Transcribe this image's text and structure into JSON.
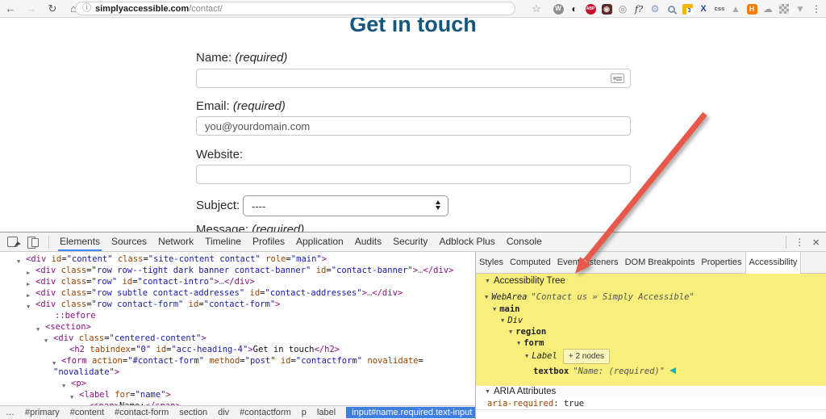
{
  "colors": {
    "heading_blue": "#15567d",
    "a11y_highlight": "#f8ee7c",
    "crumb_selected_bg": "#3d7edf",
    "annotation_arrow_red": "#e9594b",
    "devtools_tab_underline": "#4285f4"
  },
  "browser": {
    "nav": {
      "back": "←",
      "forward": "→",
      "reload": "↻",
      "home": "⌂"
    },
    "url": {
      "info_icon": "ⓘ",
      "host": "simplyaccessible.com",
      "path": "/contact/"
    },
    "bookmark_star": "☆",
    "menu_dots": "⋮",
    "extensions": [
      {
        "name": "wappalyzer-icon",
        "shape": "circle",
        "glyph": "W",
        "fg": "#ffffff",
        "bg": "#8d8d8d"
      },
      {
        "name": "contrast-icon",
        "shape": "glyph",
        "glyph": "◐",
        "fg": "#222222"
      },
      {
        "name": "adblock-plus-icon",
        "shape": "circle-small-text",
        "glyph": "ABP",
        "fg": "#ffffff",
        "bg": "#c70d2c"
      },
      {
        "name": "screen-capture-icon",
        "shape": "square",
        "glyph": "◉",
        "fg": "#e8d7d7",
        "bg": "#5a2a28"
      },
      {
        "name": "camera-icon",
        "shape": "glyph",
        "glyph": "◎",
        "fg": "#8a8a8a"
      },
      {
        "name": "function-help-icon",
        "shape": "text-italic",
        "glyph": "f?",
        "fg": "#333333"
      },
      {
        "name": "gear-icon",
        "shape": "glyph",
        "glyph": "⚙",
        "fg": "#8591c8"
      },
      {
        "name": "magnifier-icon",
        "shape": "mag",
        "glyph": "",
        "fg": "#8296ab"
      },
      {
        "name": "calendar-icon",
        "shape": "calendar",
        "glyph": "3",
        "fg": "#1a56c4",
        "bg": "#f4b400"
      },
      {
        "name": "axe-icon",
        "shape": "text-bold",
        "glyph": "X",
        "fg": "#23409a"
      },
      {
        "name": "css-icon",
        "shape": "text",
        "glyph": "css",
        "fg": "#555555"
      },
      {
        "name": "triangle-icon",
        "shape": "glyph",
        "glyph": "▲",
        "fg": "#a9a9a9"
      },
      {
        "name": "h-icon",
        "shape": "square",
        "glyph": "H",
        "fg": "#ffffff",
        "bg": "#f57c00"
      },
      {
        "name": "cloud-icon",
        "shape": "glyph",
        "glyph": "☁",
        "fg": "#9e9e9e"
      },
      {
        "name": "qr-icon",
        "shape": "qr",
        "glyph": "",
        "fg": "#a7a7a7"
      },
      {
        "name": "dropdown-icon",
        "shape": "glyph",
        "glyph": "▼",
        "fg": "#a9a9a9"
      }
    ]
  },
  "page": {
    "heading": "Get in touch",
    "name_label": "Name:",
    "name_required": "(required)",
    "name_value": "",
    "email_label": "Email:",
    "email_required": "(required)",
    "email_value": "you@yourdomain.com",
    "website_label": "Website:",
    "website_value": "",
    "subject_label": "Subject:",
    "subject_value": "----",
    "message_label": "Message:",
    "message_required": "(required)"
  },
  "devtools": {
    "tabs": [
      "Elements",
      "Sources",
      "Network",
      "Timeline",
      "Profiles",
      "Application",
      "Audits",
      "Security",
      "Adblock Plus",
      "Console"
    ],
    "active_tab": "Elements",
    "menu_dots": "⋮",
    "close": "×",
    "tree": [
      {
        "l": 32,
        "t": 2,
        "tg": "v",
        "k": [
          [
            "<div ",
            "t"
          ],
          [
            "id",
            "a"
          ],
          [
            "=",
            "p"
          ],
          [
            "\"content\"",
            "v"
          ],
          [
            " ",
            "p"
          ],
          [
            "class",
            "a"
          ],
          [
            "=",
            "p"
          ],
          [
            "\"site-content contact\"",
            "v"
          ],
          [
            " ",
            "p"
          ],
          [
            "role",
            "a"
          ],
          [
            "=",
            "p"
          ],
          [
            "\"main\"",
            "v"
          ],
          [
            ">",
            "t"
          ]
        ]
      },
      {
        "l": 44,
        "t": 16,
        "tg": ">",
        "k": [
          [
            "<div ",
            "t"
          ],
          [
            "class",
            "a"
          ],
          [
            "=",
            "p"
          ],
          [
            "\"row row--tight dark banner contact-banner\"",
            "v"
          ],
          [
            " ",
            "p"
          ],
          [
            "id",
            "a"
          ],
          [
            "=",
            "p"
          ],
          [
            "\"contact-banner\"",
            "v"
          ],
          [
            ">",
            "t"
          ],
          [
            "…",
            "d"
          ],
          [
            "</div>",
            "t"
          ]
        ]
      },
      {
        "l": 44,
        "t": 30,
        "tg": ">",
        "k": [
          [
            "<div ",
            "t"
          ],
          [
            "class",
            "a"
          ],
          [
            "=",
            "p"
          ],
          [
            "\"row\"",
            "v"
          ],
          [
            " ",
            "p"
          ],
          [
            "id",
            "a"
          ],
          [
            "=",
            "p"
          ],
          [
            "\"contact-intro\"",
            "v"
          ],
          [
            ">",
            "t"
          ],
          [
            "…",
            "d"
          ],
          [
            "</div>",
            "t"
          ]
        ]
      },
      {
        "l": 44,
        "t": 44,
        "tg": ">",
        "k": [
          [
            "<div ",
            "t"
          ],
          [
            "class",
            "a"
          ],
          [
            "=",
            "p"
          ],
          [
            "\"row subtle contact-addresses\"",
            "v"
          ],
          [
            " ",
            "p"
          ],
          [
            "id",
            "a"
          ],
          [
            "=",
            "p"
          ],
          [
            "\"contact-addresses\"",
            "v"
          ],
          [
            ">",
            "t"
          ],
          [
            "…",
            "d"
          ],
          [
            "</div>",
            "t"
          ]
        ]
      },
      {
        "l": 44,
        "t": 58,
        "tg": "v",
        "k": [
          [
            "<div ",
            "t"
          ],
          [
            "class",
            "a"
          ],
          [
            "=",
            "p"
          ],
          [
            "\"row contact-form\"",
            "v"
          ],
          [
            " ",
            "p"
          ],
          [
            "id",
            "a"
          ],
          [
            "=",
            "p"
          ],
          [
            "\"contact-form\"",
            "v"
          ],
          [
            ">",
            "t"
          ]
        ]
      },
      {
        "l": 68,
        "t": 72,
        "tg": "",
        "k": [
          [
            "::before",
            "t"
          ]
        ]
      },
      {
        "l": 56,
        "t": 86,
        "tg": "v",
        "k": [
          [
            "<section>",
            "t"
          ]
        ]
      },
      {
        "l": 66,
        "t": 100,
        "tg": "v",
        "k": [
          [
            "<div ",
            "t"
          ],
          [
            "class",
            "a"
          ],
          [
            "=",
            "p"
          ],
          [
            "\"centered-content\"",
            "v"
          ],
          [
            ">",
            "t"
          ]
        ]
      },
      {
        "l": 86,
        "t": 114,
        "tg": "",
        "k": [
          [
            "<h2 ",
            "t"
          ],
          [
            "tabindex",
            "a"
          ],
          [
            "=",
            "p"
          ],
          [
            "\"0\"",
            "v"
          ],
          [
            " ",
            "p"
          ],
          [
            "id",
            "a"
          ],
          [
            "=",
            "p"
          ],
          [
            "\"acc-heading-4\"",
            "v"
          ],
          [
            ">",
            "t"
          ],
          [
            "Get in touch",
            "p"
          ],
          [
            "</h2>",
            "t"
          ]
        ]
      },
      {
        "l": 76,
        "t": 128,
        "tg": "v",
        "k": [
          [
            "<form ",
            "t"
          ],
          [
            "action",
            "a"
          ],
          [
            "=",
            "p"
          ],
          [
            "\"#contact-form\"",
            "v"
          ],
          [
            " ",
            "p"
          ],
          [
            "method",
            "a"
          ],
          [
            "=",
            "p"
          ],
          [
            "\"post\"",
            "v"
          ],
          [
            " ",
            "p"
          ],
          [
            "id",
            "a"
          ],
          [
            "=",
            "p"
          ],
          [
            "\"contactform\"",
            "v"
          ],
          [
            " ",
            "p"
          ],
          [
            "novalidate",
            "a"
          ],
          [
            "=",
            "p"
          ]
        ]
      },
      {
        "l": 66,
        "t": 142,
        "tg": "",
        "k": [
          [
            "\"novalidate\"",
            "v"
          ],
          [
            ">",
            "t"
          ]
        ]
      },
      {
        "l": 88,
        "t": 156,
        "tg": "v",
        "k": [
          [
            "<p>",
            "t"
          ]
        ]
      },
      {
        "l": 98,
        "t": 170,
        "tg": "v",
        "k": [
          [
            "<label ",
            "t"
          ],
          [
            "for",
            "a"
          ],
          [
            "=",
            "p"
          ],
          [
            "\"name\"",
            "v"
          ],
          [
            ">",
            "t"
          ]
        ]
      },
      {
        "l": 110,
        "t": 184,
        "tg": "",
        "k": [
          [
            "<span>",
            "t"
          ],
          [
            "Name:",
            "p"
          ],
          [
            "</span>",
            "t"
          ]
        ]
      }
    ],
    "crumbs": [
      "…",
      "#primary",
      "#content",
      "#contact-form",
      "section",
      "div",
      "#contactform",
      "p",
      "label"
    ],
    "crumb_selected": "input#name.required.text-input",
    "sidebar": {
      "tabs": [
        "Styles",
        "Computed",
        "Event Listeners",
        "DOM Breakpoints",
        "Properties",
        "Accessibility"
      ],
      "active_tab": "Accessibility",
      "a11y_title": "Accessibility Tree",
      "nodes": [
        {
          "indent": 0,
          "role": "WebArea",
          "style": "italic",
          "name": "\"Contact us » Simply Accessible\""
        },
        {
          "indent": 1,
          "role": "main",
          "style": "bold"
        },
        {
          "indent": 2,
          "role": "Div",
          "style": "italic"
        },
        {
          "indent": 3,
          "role": "region",
          "style": "bold"
        },
        {
          "indent": 4,
          "role": "form",
          "style": "bold"
        },
        {
          "indent": 5,
          "role": "Label",
          "style": "italic",
          "badge": "+ 2 nodes"
        },
        {
          "indent": 6,
          "role": "textbox",
          "style": "bold",
          "name": "\"Name: (required)\"",
          "arrow": true,
          "leaf": true
        }
      ],
      "aria_title": "ARIA Attributes",
      "aria_attrs": [
        {
          "n": "aria-required",
          "v": "true"
        }
      ]
    }
  }
}
